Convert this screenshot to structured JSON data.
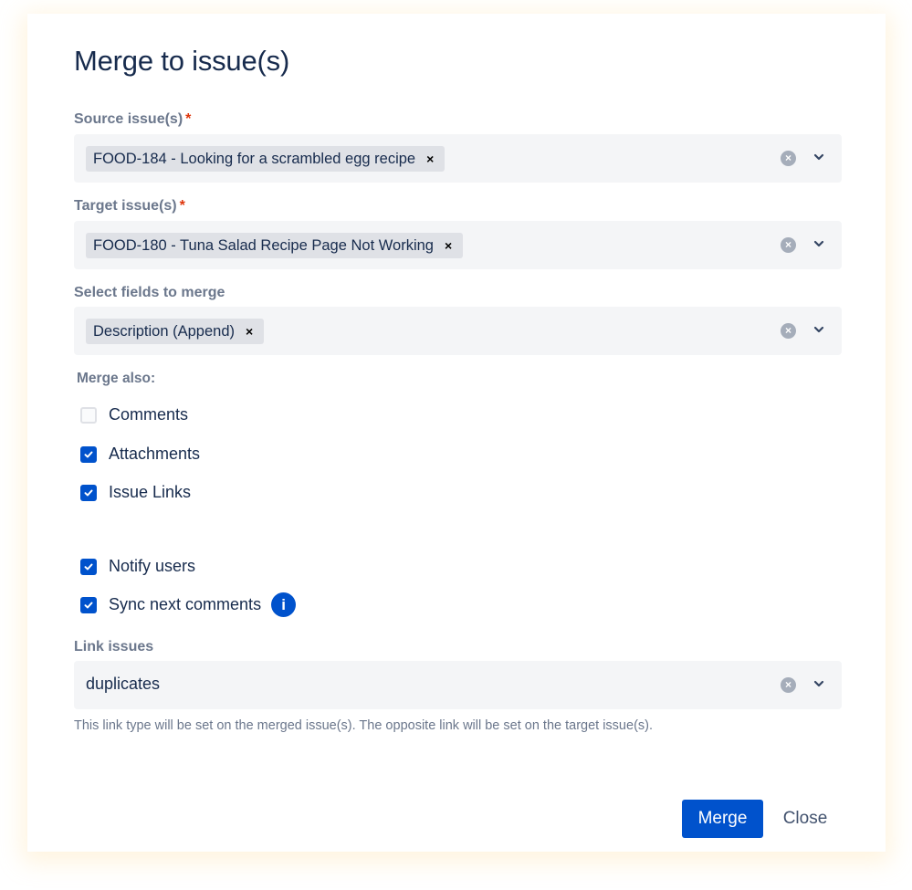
{
  "dialog": {
    "title": "Merge to issue(s)",
    "required_marker": "*",
    "source": {
      "label": "Source issue(s)",
      "tags": [
        "FOOD-184 - Looking for a scrambled egg recipe"
      ]
    },
    "target": {
      "label": "Target issue(s)",
      "tags": [
        "FOOD-180 - Tuna Salad Recipe Page Not Working"
      ]
    },
    "fields": {
      "label": "Select fields to merge",
      "tags": [
        "Description (Append)"
      ]
    },
    "merge_also": {
      "label": "Merge also:",
      "options": [
        {
          "label": "Comments",
          "checked": false
        },
        {
          "label": "Attachments",
          "checked": true
        },
        {
          "label": "Issue Links",
          "checked": true
        }
      ]
    },
    "notify_users": {
      "label": "Notify users",
      "checked": true
    },
    "sync_comments": {
      "label": "Sync next comments",
      "checked": true,
      "info_icon": "i"
    },
    "link_issues": {
      "label": "Link issues",
      "value": "duplicates",
      "helper": "This link type will be set on the merged issue(s). The opposite link will be set on the target issue(s)."
    },
    "tag_remove_glyph": "×",
    "clear_glyph": "×",
    "buttons": {
      "merge": "Merge",
      "close": "Close"
    }
  }
}
